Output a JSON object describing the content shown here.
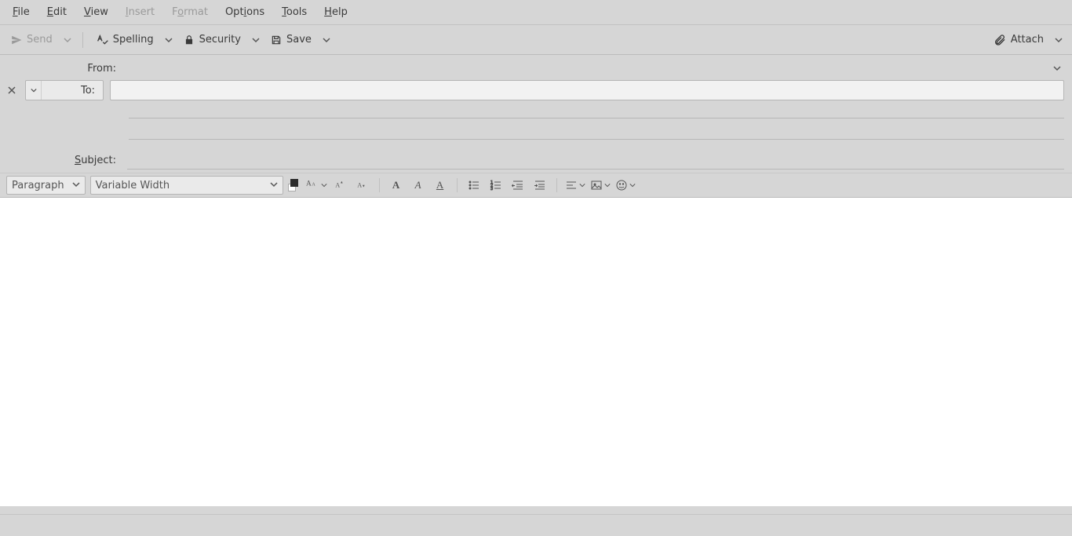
{
  "menu": {
    "file": {
      "pre": "",
      "u": "F",
      "post": "ile",
      "enabled": true
    },
    "edit": {
      "pre": "",
      "u": "E",
      "post": "dit",
      "enabled": true
    },
    "view": {
      "pre": "",
      "u": "V",
      "post": "iew",
      "enabled": true
    },
    "insert": {
      "pre": "",
      "u": "I",
      "post": "nsert",
      "enabled": false
    },
    "format": {
      "pre": "F",
      "u": "o",
      "post": "rmat",
      "enabled": false
    },
    "options": {
      "pre": "Opt",
      "u": "i",
      "post": "ons",
      "enabled": true
    },
    "tools": {
      "pre": "",
      "u": "T",
      "post": "ools",
      "enabled": true
    },
    "help": {
      "pre": "",
      "u": "H",
      "post": "elp",
      "enabled": true
    }
  },
  "toolbar": {
    "send": "Send",
    "spelling": "Spelling",
    "security": "Security",
    "save": "Save",
    "attach": "Attach"
  },
  "header": {
    "from_label": "From:",
    "from_value": "",
    "to_label": "To:",
    "to_value": "",
    "subject_label_pre": "",
    "subject_label_u": "S",
    "subject_label_post": "ubject:",
    "subject_value": ""
  },
  "format": {
    "paragraph_style": "Paragraph",
    "font_family": "Variable Width"
  },
  "icons": {
    "send": "send-icon",
    "chevron_down": "chevron-down-icon",
    "spellcheck": "spellcheck-icon",
    "lock": "lock-icon",
    "save_disk": "save-icon",
    "paperclip": "paperclip-icon"
  }
}
